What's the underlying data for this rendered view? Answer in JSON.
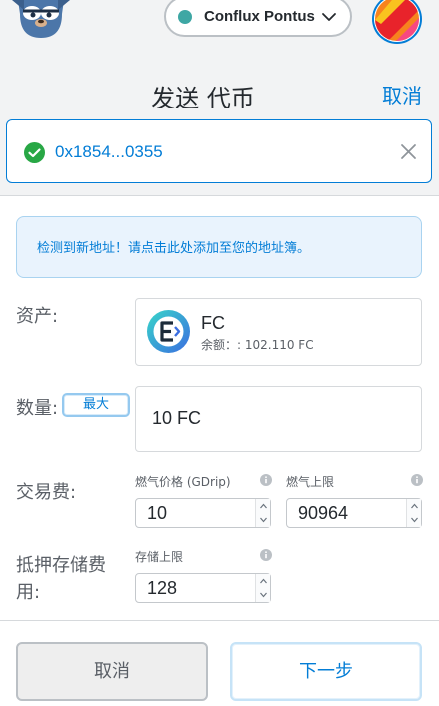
{
  "header": {
    "network_name": "Conflux Pontus",
    "network_dot_color": "#3ea7a4",
    "logo_icon": "fox-logo-icon",
    "account_icon": "account-identicon"
  },
  "send": {
    "title": "发送 代币",
    "cancel_link": "取消"
  },
  "recipient": {
    "address": "0x1854...0355",
    "status_icon": "check-circle-icon",
    "clear_icon": "close-icon"
  },
  "alert": {
    "text": "检测到新地址！请点击此处添加至您的地址簿。"
  },
  "asset": {
    "label": "资产:",
    "token_name": "FC",
    "balance": "余额：: 102.110 FC"
  },
  "amount": {
    "label": "数量:",
    "max_label": "最大",
    "value": "10 FC"
  },
  "fee": {
    "label": "交易费:",
    "gas_price_label": "燃气价格 (GDrip)",
    "gas_price_value": "10",
    "gas_limit_label": "燃气上限",
    "gas_limit_value": "90964"
  },
  "storage": {
    "label_line1": "抵押存储费",
    "label_line2": "用:",
    "limit_label": "存储上限",
    "limit_value": "128"
  },
  "footer": {
    "cancel": "取消",
    "next": "下一步"
  },
  "colors": {
    "accent": "#037dd6",
    "success": "#28a745"
  }
}
